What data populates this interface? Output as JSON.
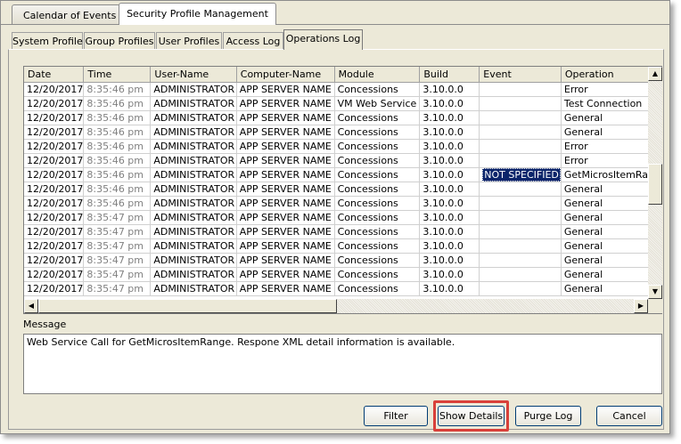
{
  "window_tabs": [
    "Calendar of Events",
    "Security Profile Management"
  ],
  "inner_tabs": [
    "System Profile",
    "Group Profiles",
    "User Profiles",
    "Access Log",
    "Operations Log"
  ],
  "grid": {
    "columns": [
      "Date",
      "Time",
      "User-Name",
      "Computer-Name",
      "Module",
      "Build",
      "Event",
      "Operation"
    ],
    "rows": [
      [
        "12/20/2017",
        "8:35:46 pm",
        "ADMINISTRATOR",
        "APP SERVER NAME",
        "Concessions",
        "3.10.0.0",
        "",
        "Error"
      ],
      [
        "12/20/2017",
        "8:35:46 pm",
        "ADMINISTRATOR",
        "APP SERVER NAME",
        "VM Web Service",
        "3.10.0.0",
        "",
        "Test Connection"
      ],
      [
        "12/20/2017",
        "8:35:46 pm",
        "ADMINISTRATOR",
        "APP SERVER NAME",
        "Concessions",
        "3.10.0.0",
        "",
        "General"
      ],
      [
        "12/20/2017",
        "8:35:46 pm",
        "ADMINISTRATOR",
        "APP SERVER NAME",
        "Concessions",
        "3.10.0.0",
        "",
        "General"
      ],
      [
        "12/20/2017",
        "8:35:46 pm",
        "ADMINISTRATOR",
        "APP SERVER NAME",
        "Concessions",
        "3.10.0.0",
        "",
        "Error"
      ],
      [
        "12/20/2017",
        "8:35:46 pm",
        "ADMINISTRATOR",
        "APP SERVER NAME",
        "Concessions",
        "3.10.0.0",
        "",
        "Error"
      ],
      [
        "12/20/2017",
        "8:35:46 pm",
        "ADMINISTRATOR",
        "APP SERVER NAME",
        "Concessions",
        "3.10.0.0",
        "NOT SPECIFIED",
        "GetMicrosItemRang"
      ],
      [
        "12/20/2017",
        "8:35:46 pm",
        "ADMINISTRATOR",
        "APP SERVER NAME",
        "Concessions",
        "3.10.0.0",
        "",
        "General"
      ],
      [
        "12/20/2017",
        "8:35:46 pm",
        "ADMINISTRATOR",
        "APP SERVER NAME",
        "Concessions",
        "3.10.0.0",
        "",
        "General"
      ],
      [
        "12/20/2017",
        "8:35:47 pm",
        "ADMINISTRATOR",
        "APP SERVER NAME",
        "Concessions",
        "3.10.0.0",
        "",
        "General"
      ],
      [
        "12/20/2017",
        "8:35:47 pm",
        "ADMINISTRATOR",
        "APP SERVER NAME",
        "Concessions",
        "3.10.0.0",
        "",
        "General"
      ],
      [
        "12/20/2017",
        "8:35:47 pm",
        "ADMINISTRATOR",
        "APP SERVER NAME",
        "Concessions",
        "3.10.0.0",
        "",
        "General"
      ],
      [
        "12/20/2017",
        "8:35:47 pm",
        "ADMINISTRATOR",
        "APP SERVER NAME",
        "Concessions",
        "3.10.0.0",
        "",
        "General"
      ],
      [
        "12/20/2017",
        "8:35:47 pm",
        "ADMINISTRATOR",
        "APP SERVER NAME",
        "Concessions",
        "3.10.0.0",
        "",
        "General"
      ],
      [
        "12/20/2017",
        "8:35:47 pm",
        "ADMINISTRATOR",
        "APP SERVER NAME",
        "Concessions",
        "3.10.0.0",
        "",
        "General"
      ]
    ]
  },
  "message": {
    "label": "Message",
    "text": "Web Service Call for GetMicrosItemRange. Respone XML detail information is available."
  },
  "buttons": {
    "filter": "Filter",
    "show_details": "Show Details",
    "purge_log": "Purge Log",
    "cancel": "Cancel"
  },
  "colors": {
    "highlight": "#d9403a",
    "selection": "#0a246a"
  },
  "icons": {
    "scroll_up": "triangle-up",
    "scroll_down": "triangle-down",
    "scroll_left": "triangle-left",
    "scroll_right": "triangle-right"
  }
}
